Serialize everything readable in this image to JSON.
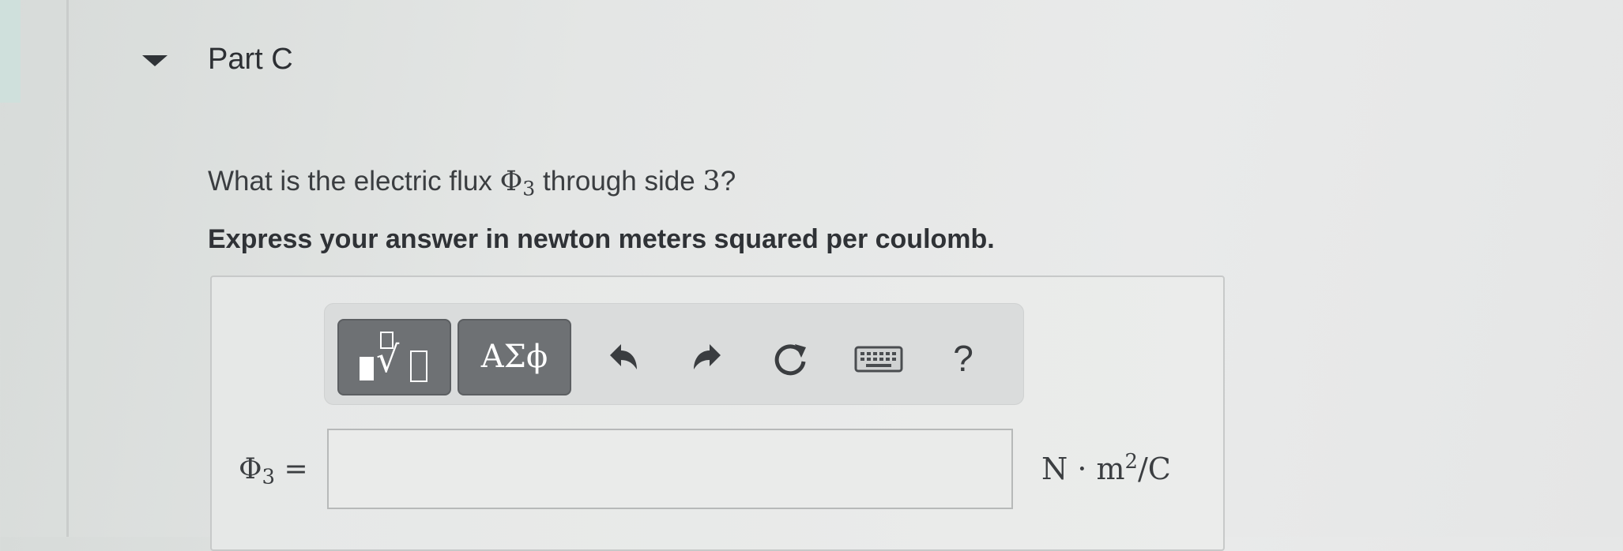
{
  "part": {
    "title": "Part C"
  },
  "question": {
    "prefix": "What is the electric flux ",
    "symbol": "Φ",
    "symbol_subscript": "3",
    "suffix_text": " through side ",
    "side_number": "3",
    "question_mark": "?"
  },
  "instruction": "Express your answer in newton meters squared per coulomb.",
  "toolbar": {
    "templates_icon": "templates-radical-icon",
    "greek_label": "ΑΣϕ",
    "undo_icon": "undo-icon",
    "redo_icon": "redo-icon",
    "reset_icon": "reset-icon",
    "keyboard_icon": "keyboard-icon",
    "help_label": "?"
  },
  "answer": {
    "label_symbol": "Φ",
    "label_subscript": "3",
    "label_equals": " =",
    "value": "",
    "units_base": "N · m",
    "units_exponent": "2",
    "units_tail": "/C"
  },
  "colors": {
    "toolbar_button": "#6e7174",
    "background": "#e6e8e7"
  }
}
